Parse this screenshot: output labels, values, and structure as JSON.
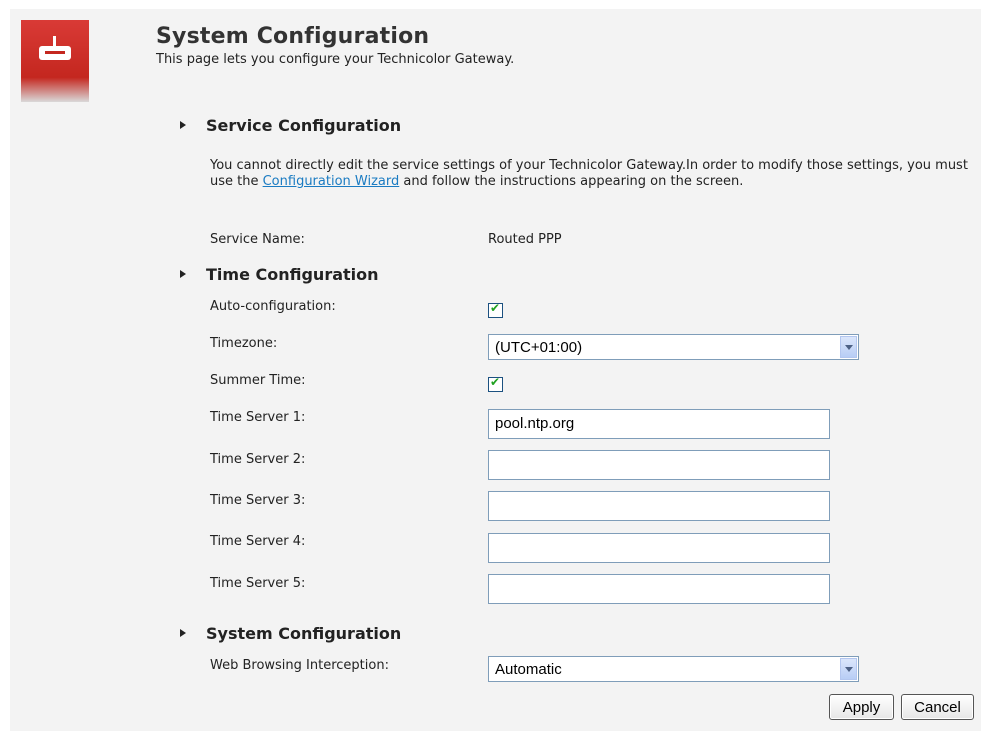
{
  "header": {
    "title": "System Configuration",
    "subtitle": "This page lets you configure your Technicolor Gateway.",
    "logo_icon": "gateway-router-icon"
  },
  "service_section": {
    "heading": "Service Configuration",
    "description_part1": "You cannot directly edit the service settings of your Technicolor Gateway.In order to modify those settings, you must use the ",
    "wizard_link": "Configuration Wizard",
    "description_part2": " and follow the instructions appearing on the screen.",
    "service_name_label": "Service Name:",
    "service_name_value": "Routed PPP"
  },
  "time_section": {
    "heading": "Time Configuration",
    "auto_config_label": "Auto-configuration:",
    "auto_config_checked": true,
    "timezone_label": "Timezone:",
    "timezone_value": "(UTC+01:00)",
    "summer_time_label": "Summer Time:",
    "summer_time_checked": true,
    "servers": [
      {
        "label": "Time Server 1:",
        "value": "pool.ntp.org"
      },
      {
        "label": "Time Server 2:",
        "value": ""
      },
      {
        "label": "Time Server 3:",
        "value": ""
      },
      {
        "label": "Time Server 4:",
        "value": ""
      },
      {
        "label": "Time Server 5:",
        "value": ""
      }
    ]
  },
  "system_section": {
    "heading": "System Configuration",
    "web_interception_label": "Web Browsing Interception:",
    "web_interception_value": "Automatic"
  },
  "actions": {
    "apply_label": "Apply",
    "cancel_label": "Cancel"
  },
  "colors": {
    "brand_red": "#c4271f",
    "link_blue": "#1a7bc2",
    "check_green": "#21a121"
  }
}
